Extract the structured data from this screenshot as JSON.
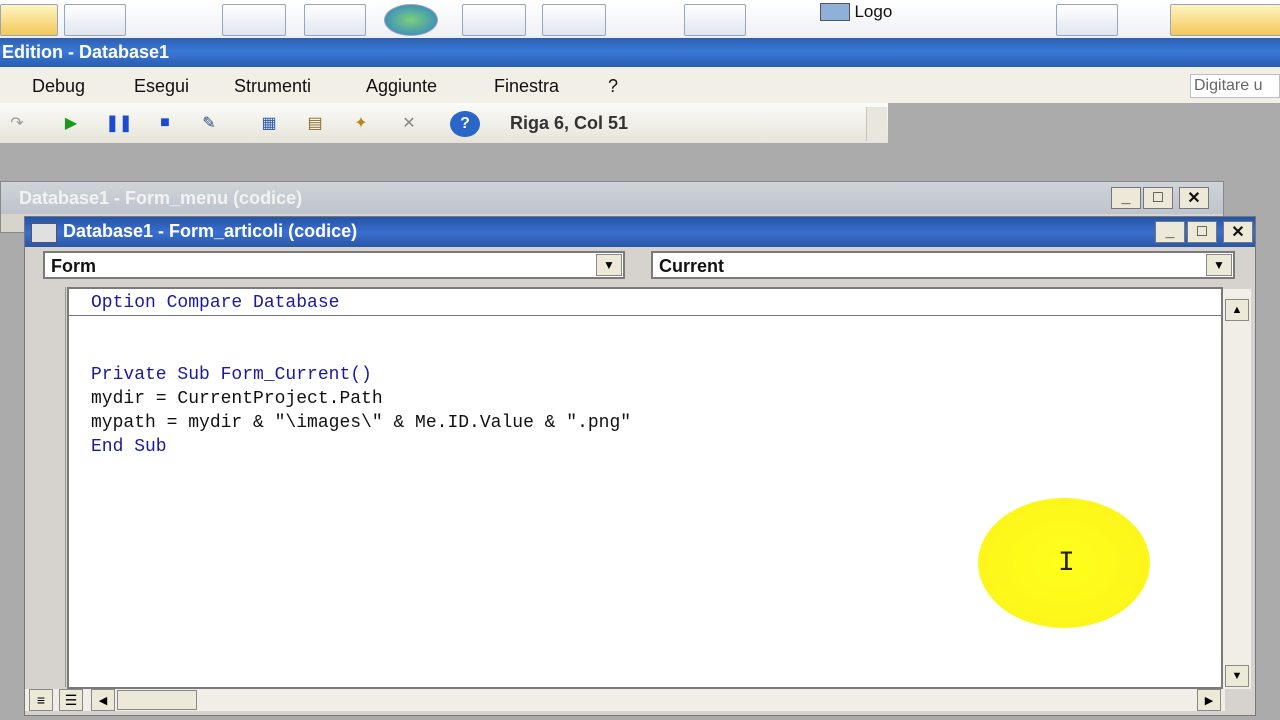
{
  "ribbon": {
    "logo_label": "Logo"
  },
  "window": {
    "title": "Edition - Database1"
  },
  "menu": {
    "items": [
      {
        "label": "Debug"
      },
      {
        "label": "Esegui"
      },
      {
        "label": "Strumenti"
      },
      {
        "label": "Aggiunte"
      },
      {
        "label": "Finestra"
      },
      {
        "label": "?"
      }
    ],
    "search_hint": "Digitare u"
  },
  "toolbar": {
    "position": "Riga 6, Col 51"
  },
  "windows": {
    "back": {
      "title": "Database1 - Form_menu (codice)"
    },
    "front": {
      "title": "Database1 - Form_articoli (codice)"
    }
  },
  "code": {
    "object_combo": "Form",
    "procedure_combo": "Current",
    "lines": {
      "l1": "Option Compare Database",
      "l3": "Private Sub Form_Current()",
      "l4": "mydir = CurrentProject.Path",
      "l5": "mypath = mydir & \"\\images\\\" & Me.ID.Value & \".png\"",
      "l6": "End Sub"
    }
  },
  "colors": {
    "title_active": "#2a5db0",
    "keyword": "#1a1aa0",
    "highlight": "#ffff00"
  }
}
